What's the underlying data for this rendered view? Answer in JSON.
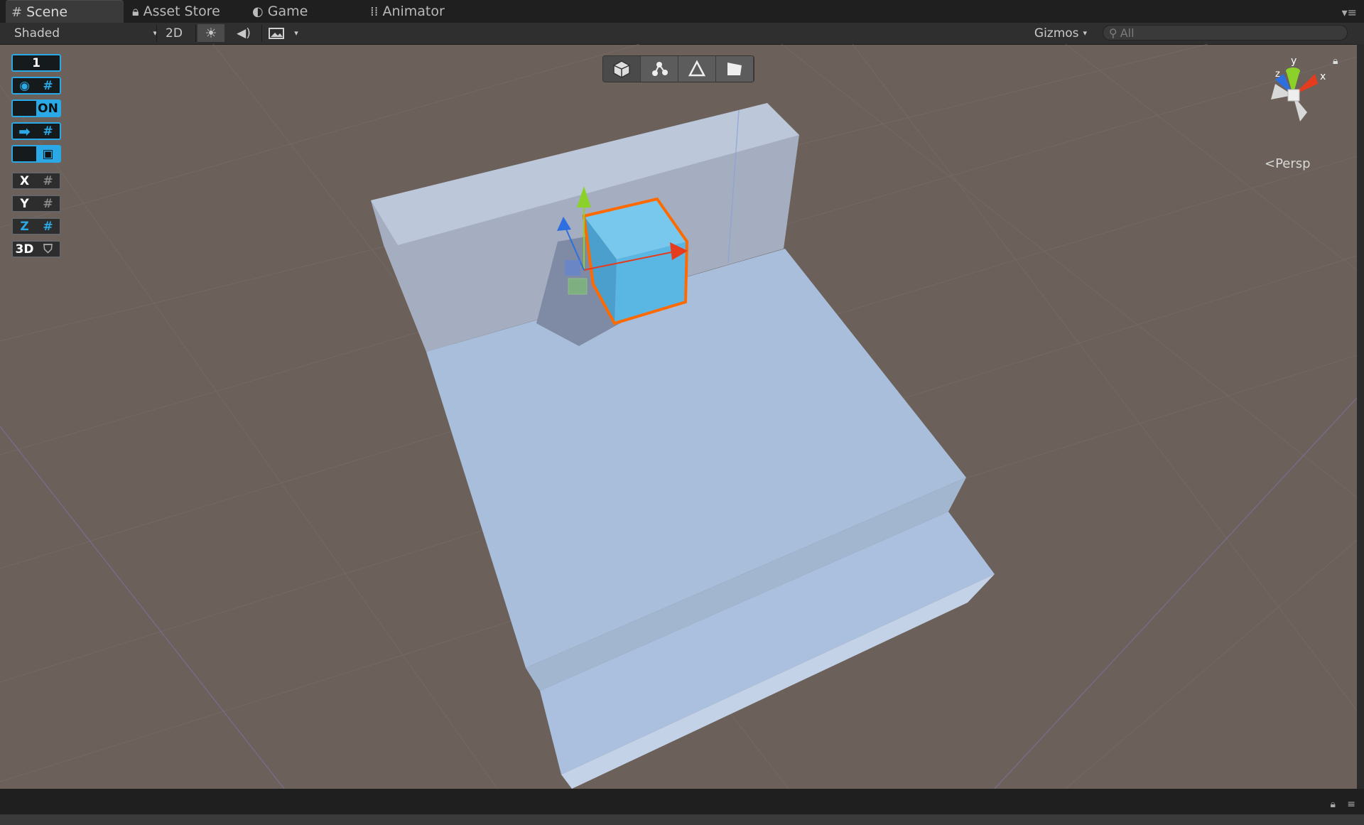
{
  "tabs": [
    {
      "label": "Scene",
      "icon": "grid-icon",
      "active": true
    },
    {
      "label": "Asset Store",
      "icon": "lock-icon",
      "active": false
    },
    {
      "label": "Game",
      "icon": "pacman-icon",
      "active": false
    },
    {
      "label": "Animator",
      "icon": "dots-icon",
      "active": false
    }
  ],
  "toolbar": {
    "shading_mode": "Shaded",
    "mode_2d": "2D",
    "gizmos_label": "Gizmos",
    "search_placeholder": "All"
  },
  "left_toolbar": {
    "layer_count": "1",
    "snap_on_label": "ON",
    "axis_x": "X",
    "axis_y": "Y",
    "axis_z": "Z",
    "mode_3d": "3D"
  },
  "orientation_gizmo": {
    "y_label": "y",
    "x_label": "x",
    "z_label": "z",
    "projection": "Persp"
  },
  "colors": {
    "accent": "#2aa9e6",
    "selection_outline": "#ff6a00",
    "cube": "#5ab6e2",
    "ground": "#6b605a",
    "geometry": "#aabfdc"
  }
}
